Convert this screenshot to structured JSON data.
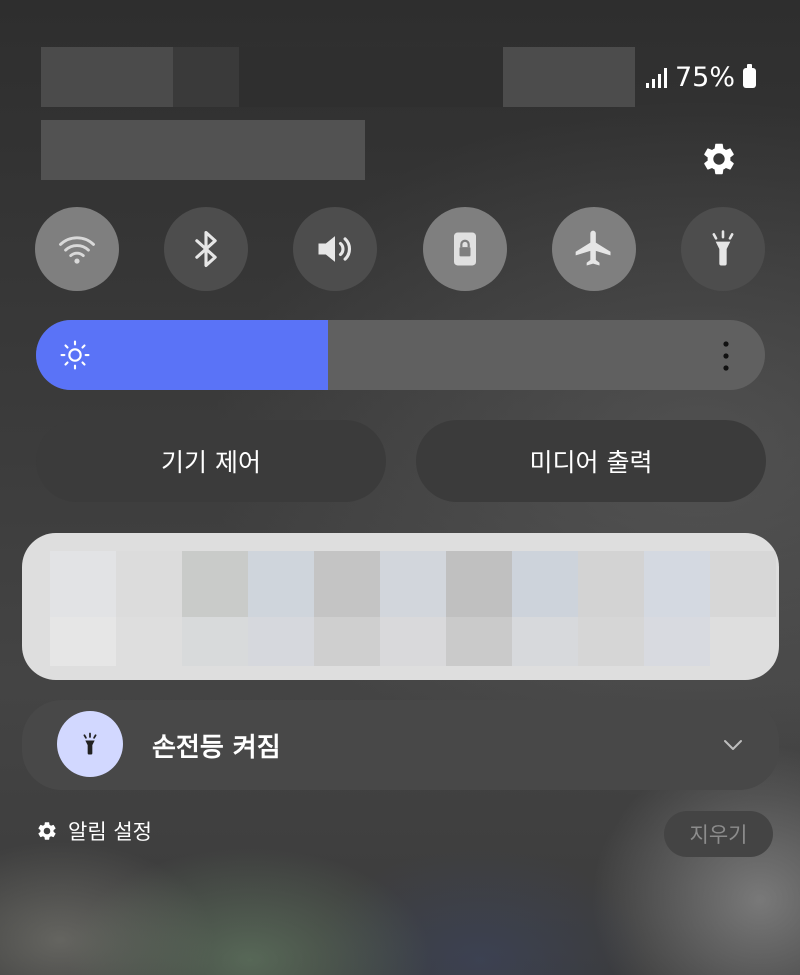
{
  "status_bar": {
    "battery_percent": "75%",
    "signal_icon": "signal-icon",
    "battery_icon": "battery-icon"
  },
  "header": {
    "settings_icon": "gear-icon"
  },
  "quick_toggles": [
    {
      "name": "wifi",
      "icon": "wifi-icon",
      "state": "on"
    },
    {
      "name": "bluetooth",
      "icon": "bluetooth-icon",
      "state": "off"
    },
    {
      "name": "sound",
      "icon": "volume-icon",
      "state": "off"
    },
    {
      "name": "rotation-lock",
      "icon": "lock-icon",
      "state": "on"
    },
    {
      "name": "airplane-mode",
      "icon": "airplane-icon",
      "state": "on"
    },
    {
      "name": "flashlight",
      "icon": "flashlight-icon",
      "state": "off"
    }
  ],
  "brightness": {
    "level": 0.4,
    "icon": "sun-icon",
    "menu_icon": "more-vertical-icon",
    "fill_color": "#5a73f7"
  },
  "buttons": {
    "device_control": "기기 제어",
    "media_output": "미디어 출력"
  },
  "notification": {
    "icon": "flashlight-icon",
    "title": "손전등 켜짐",
    "expand_icon": "chevron-down-icon"
  },
  "footer": {
    "settings_label": "알림 설정",
    "clear_label": "지우기"
  }
}
